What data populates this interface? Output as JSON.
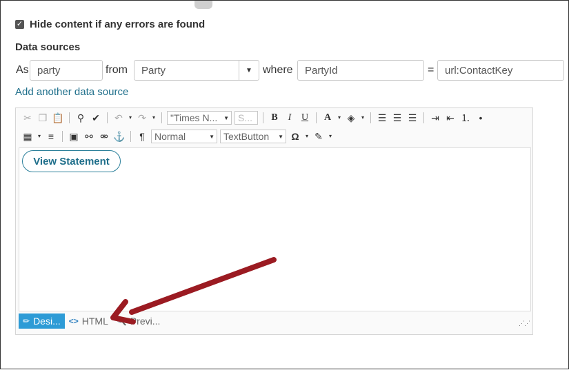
{
  "hide_content": {
    "checked": true,
    "label": "Hide content if any errors are found"
  },
  "data_sources": {
    "title": "Data sources",
    "as_label": "As",
    "alias_value": "party",
    "from_label": "from",
    "source_value": "Party",
    "where_label": "where",
    "field_value": "PartyId",
    "equals": "=",
    "value_value": "url:ContactKey",
    "add_link": "Add another data source"
  },
  "toolbar": {
    "font_name": "\"Times N...",
    "font_size": "S...",
    "format": "Normal",
    "style": "TextButton"
  },
  "content": {
    "button_label": "View Statement"
  },
  "tabs": [
    {
      "label": "Desi...",
      "icon": "pencil-icon",
      "active": true
    },
    {
      "label": "HTML",
      "icon": "code-icon",
      "active": false
    },
    {
      "label": "Previ...",
      "icon": "magnifier-icon",
      "active": false
    }
  ],
  "colors": {
    "accent": "#1f6f8b",
    "active_tab": "#2d9bd6",
    "arrow": "#9b1b22"
  }
}
